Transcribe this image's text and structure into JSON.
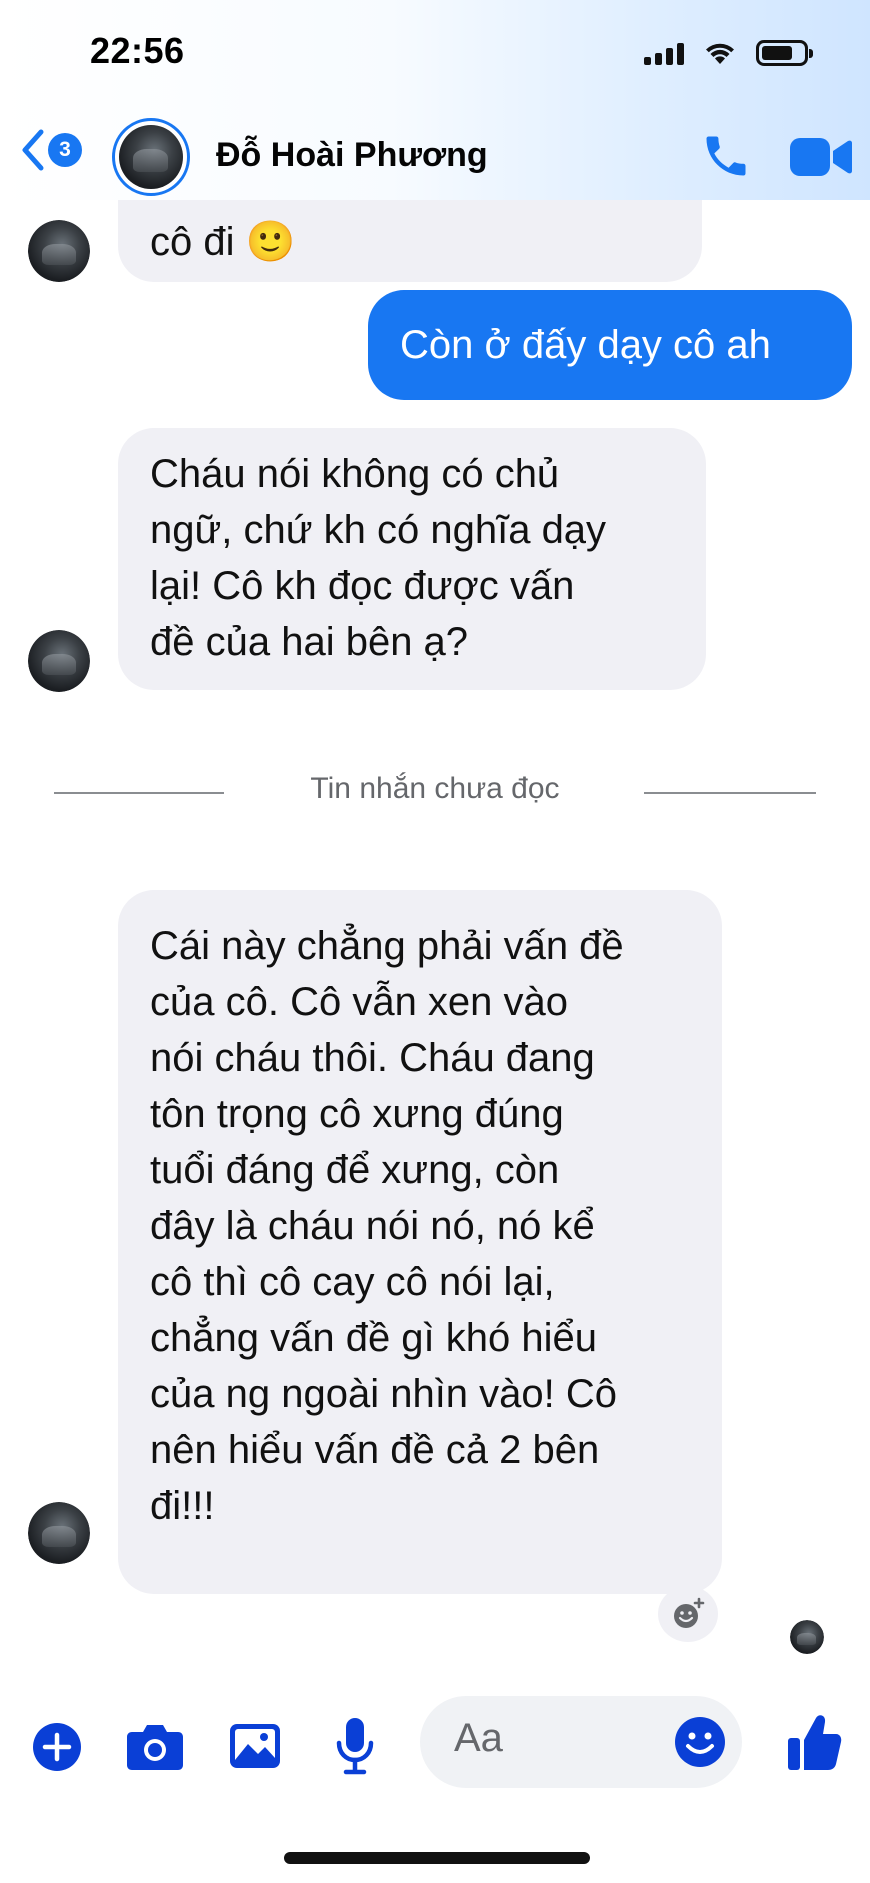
{
  "status_bar": {
    "time": "22:56"
  },
  "header": {
    "back_count": "3",
    "contact_name": "Đỗ Hoài Phương"
  },
  "messages": [
    {
      "direction": "incoming",
      "lines": [
        "cô đi 🙂"
      ]
    },
    {
      "direction": "outgoing",
      "lines": [
        "Còn ở đấy dạy cô ah"
      ]
    },
    {
      "direction": "incoming",
      "lines": [
        "Cháu nói không có chủ",
        "ngữ, chứ kh có nghĩa dạy",
        "lại! Cô kh đọc được vấn",
        "đề của hai bên ạ?"
      ]
    },
    {
      "direction": "incoming",
      "lines": [
        "Cái này chẳng phải vấn đề",
        "của cô. Cô vẫn xen vào",
        "nói cháu thôi. Cháu đang",
        "tôn trọng cô xưng đúng",
        "tuổi đáng để xưng, còn",
        "đây là cháu nói nó, nó kể",
        "cô thì cô cay cô nói lại,",
        "chẳng vấn đề gì khó hiểu",
        "của ng ngoài nhìn vào! Cô",
        "nên hiểu vấn đề cả 2 bên",
        "đi!!!"
      ]
    }
  ],
  "divider_label": "Tin nhắn chưa đọc",
  "composer": {
    "placeholder": "Aa"
  },
  "icons": {
    "back": "chevron-left-icon",
    "call": "phone-icon",
    "video": "video-camera-icon",
    "plus": "plus-circle-icon",
    "camera": "camera-icon",
    "gallery": "image-icon",
    "mic": "microphone-icon",
    "emoji": "smiley-icon",
    "like": "thumbs-up-icon",
    "react": "add-reaction-icon"
  },
  "colors": {
    "accent": "#1877f2",
    "incoming_bubble": "#f0f0f5",
    "outgoing_bubble": "#1877f2",
    "composer_icon": "#0a3fd6"
  }
}
